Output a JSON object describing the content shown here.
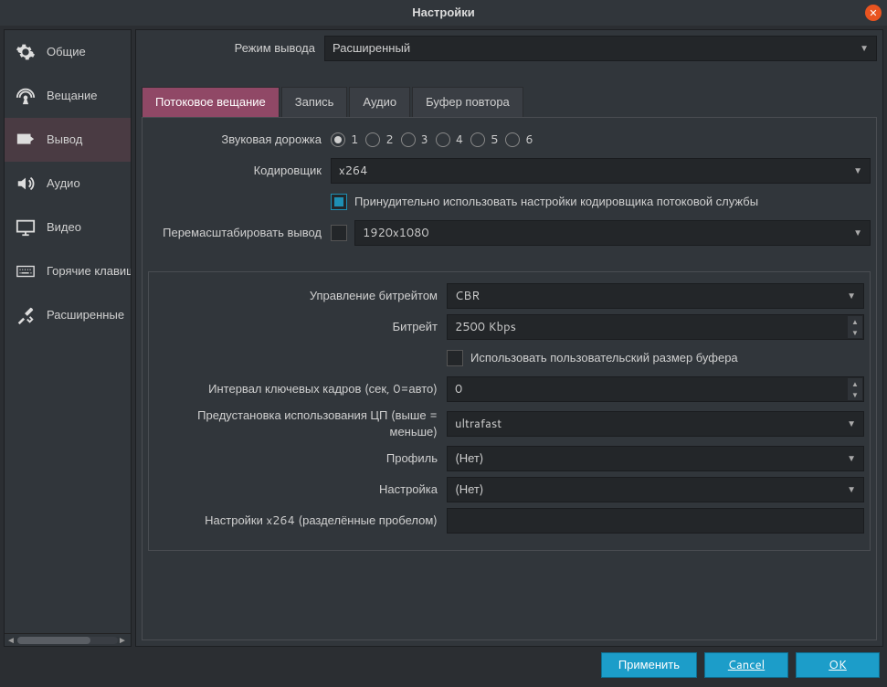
{
  "window": {
    "title": "Настройки"
  },
  "sidebar": {
    "items": [
      {
        "label": "Общие"
      },
      {
        "label": "Вещание"
      },
      {
        "label": "Вывод"
      },
      {
        "label": "Аудио"
      },
      {
        "label": "Видео"
      },
      {
        "label": "Горячие клавиши"
      },
      {
        "label": "Расширенные"
      }
    ],
    "active_index": 2
  },
  "output_mode": {
    "label": "Режим вывода",
    "value": "Расширенный"
  },
  "tabs": [
    {
      "label": "Потоковое вещание"
    },
    {
      "label": "Запись"
    },
    {
      "label": "Аудио"
    },
    {
      "label": "Буфер повтора"
    }
  ],
  "tabs_active": 0,
  "streaming": {
    "audio_track_label": "Звуковая дорожка",
    "audio_tracks": [
      "1",
      "2",
      "3",
      "4",
      "5",
      "6"
    ],
    "audio_track_selected": 0,
    "encoder_label": "Кодировщик",
    "encoder_value": "x264",
    "enforce_label": "Принудительно использовать настройки кодировщика потоковой службы",
    "enforce_checked": true,
    "rescale_label": "Перемасштабировать вывод",
    "rescale_checked": false,
    "rescale_value": "1920x1080"
  },
  "encoder_settings": {
    "rate_control_label": "Управление битрейтом",
    "rate_control_value": "CBR",
    "bitrate_label": "Битрейт",
    "bitrate_value": "2500 Kbps",
    "custom_buffer_label": "Использовать пользовательский размер буфера",
    "custom_buffer_checked": false,
    "keyint_label": "Интервал ключевых кадров (сек, 0=авто)",
    "keyint_value": "0",
    "cpu_preset_label": "Предустановка использования ЦП (выше = меньше)",
    "cpu_preset_value": "ultrafast",
    "profile_label": "Профиль",
    "profile_value": "(Нет)",
    "tune_label": "Настройка",
    "tune_value": "(Нет)",
    "x264opts_label": "Настройки x264 (разделённые пробелом)",
    "x264opts_value": ""
  },
  "footer": {
    "apply": "Применить",
    "cancel": "Cancel",
    "ok": "OK"
  }
}
